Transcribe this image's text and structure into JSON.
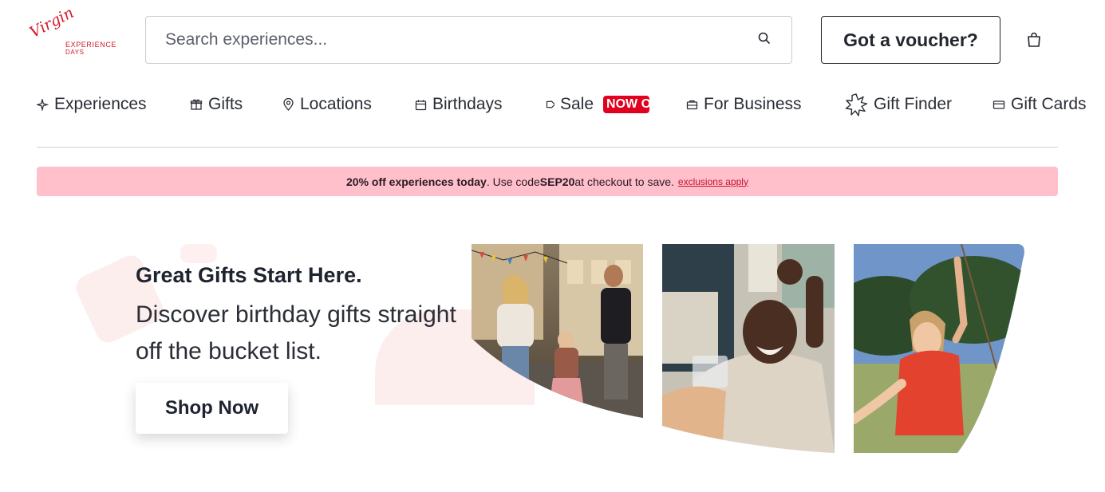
{
  "brand": {
    "logo_script": "Virgin",
    "logo_line1": "EXPERIENCE",
    "logo_line2": "DAYS",
    "accent": "#d4172a"
  },
  "search": {
    "placeholder": "Search experiences...",
    "value": "",
    "icon": "search-icon"
  },
  "header": {
    "voucher_label": "Got a voucher?",
    "bag_icon": "shopping-bag-icon"
  },
  "nav": {
    "items": [
      {
        "label": "Experiences",
        "icon": "sparkle-icon"
      },
      {
        "label": "Gifts",
        "icon": "gift-icon"
      },
      {
        "label": "Locations",
        "icon": "location-pin-icon"
      },
      {
        "label": "Birthdays",
        "icon": "calendar-icon"
      },
      {
        "label": "Sale",
        "icon": "tag-icon",
        "badge": "NOW ON!"
      },
      {
        "label": "For Business",
        "icon": "briefcase-icon"
      },
      {
        "label": "Gift Finder",
        "icon": "starburst-icon"
      },
      {
        "label": "Gift Cards",
        "icon": "card-icon"
      }
    ],
    "badge_color": "#e1001d"
  },
  "promo": {
    "bold_text": "20% off experiences today",
    "text_before_code": ". Use code ",
    "code": "SEP20",
    "text_after_code": " at checkout to save.",
    "link": "exclusions apply",
    "background": "#ffbfcb"
  },
  "hero": {
    "title": "Great Gifts Start Here.",
    "subtitle": "Discover birthday gifts straight off the bucket list.",
    "cta": "Shop Now"
  }
}
